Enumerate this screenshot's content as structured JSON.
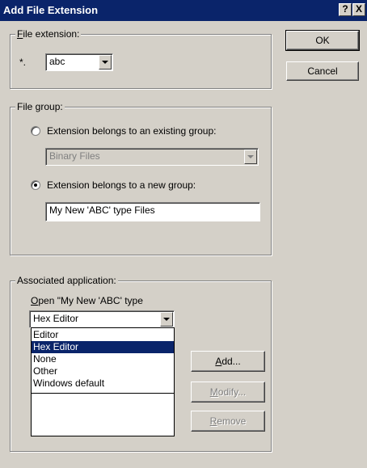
{
  "window": {
    "title": "Add File Extension",
    "help_glyph": "?",
    "close_glyph": "X"
  },
  "file_extension": {
    "legend": "File extension:",
    "prefix": "*.",
    "value": "abc"
  },
  "buttons": {
    "ok": "OK",
    "cancel": "Cancel",
    "add": "Add...",
    "modify": "Modify...",
    "remove": "Remove"
  },
  "file_group": {
    "legend": "File group:",
    "existing_label": "Extension belongs to an existing group:",
    "existing_value": "Binary Files",
    "new_label": "Extension belongs to a new group:",
    "new_value": "My New 'ABC' type Files",
    "selected": "new"
  },
  "associated_application": {
    "legend": "Associated application:",
    "open_label": "Open \"My New 'ABC' type",
    "selected_value": "Hex Editor",
    "options": [
      "Editor",
      "Hex Editor",
      "None",
      "Other",
      "Windows default"
    ],
    "highlighted_index": 1
  },
  "colors": {
    "titlebar": "#0a246a",
    "face": "#d4d0c8",
    "selection": "#0a246a"
  }
}
